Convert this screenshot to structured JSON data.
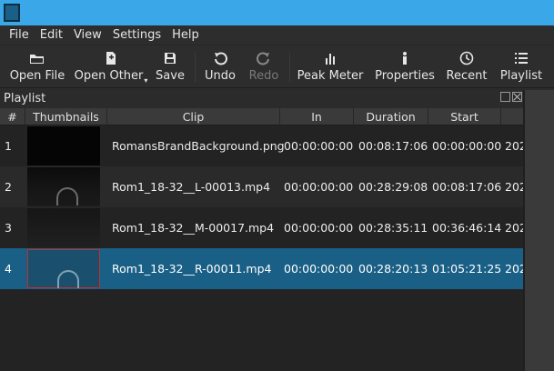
{
  "menu": [
    {
      "label": "File"
    },
    {
      "label": "Edit"
    },
    {
      "label": "View"
    },
    {
      "label": "Settings"
    },
    {
      "label": "Help"
    }
  ],
  "toolbar": {
    "open_file": "Open File",
    "open_other": "Open Other",
    "save": "Save",
    "undo": "Undo",
    "redo": "Redo",
    "peak_meter": "Peak Meter",
    "properties": "Properties",
    "recent": "Recent",
    "playlist": "Playlist"
  },
  "panel": {
    "title": "Playlist"
  },
  "table": {
    "columns": [
      "#",
      "Thumbnails",
      "Clip",
      "In",
      "Duration",
      "Start"
    ],
    "rows": [
      {
        "num": "1",
        "clip": "RomansBrandBackground.png",
        "in": "00:00:00:00",
        "duration": "00:08:17:06",
        "start": "00:00:00:00",
        "extra": "202"
      },
      {
        "num": "2",
        "clip": "Rom1_18-32__L-00013.mp4",
        "in": "00:00:00:00",
        "duration": "00:28:29:08",
        "start": "00:08:17:06",
        "extra": "202"
      },
      {
        "num": "3",
        "clip": "Rom1_18-32__M-00017.mp4",
        "in": "00:00:00:00",
        "duration": "00:28:35:11",
        "start": "00:36:46:14",
        "extra": "202"
      },
      {
        "num": "4",
        "clip": "Rom1_18-32__R-00011.mp4",
        "in": "00:00:00:00",
        "duration": "00:28:20:13",
        "start": "01:05:21:25",
        "extra": "202"
      }
    ],
    "selected_row": "4"
  },
  "colors": {
    "titlebar": "#3aa8e8",
    "selection": "#1a5f86"
  }
}
